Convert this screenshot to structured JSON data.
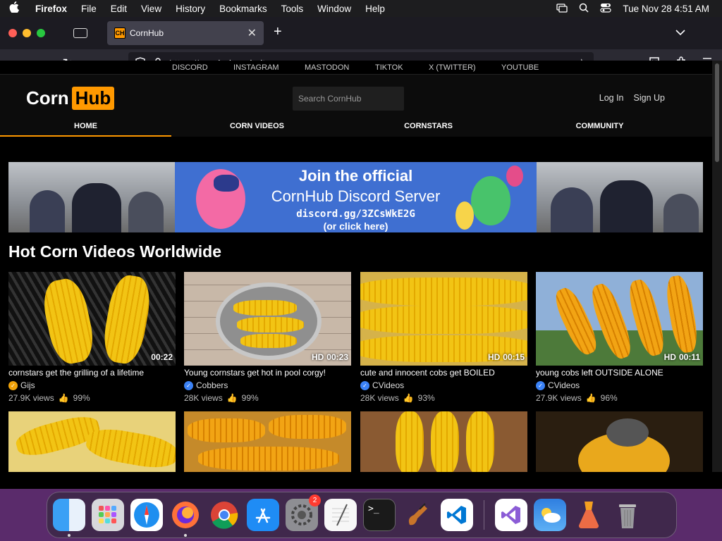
{
  "menubar": {
    "app": "Firefox",
    "items": [
      "File",
      "Edit",
      "View",
      "History",
      "Bookmarks",
      "Tools",
      "Window",
      "Help"
    ],
    "datetime": "Tue Nov 28  4:51 AM"
  },
  "browser": {
    "tab_title": "CornHub",
    "favicon_text": "CH",
    "url_proto": "https://",
    "url_host": "cornhub.website"
  },
  "site": {
    "social_links": [
      "DISCORD",
      "INSTAGRAM",
      "MASTODON",
      "TIKTOK",
      "X (TWITTER)",
      "YOUTUBE"
    ],
    "logo_left": "Corn",
    "logo_right": "Hub",
    "search_placeholder": "Search CornHub",
    "login": "Log In",
    "signup": "Sign Up",
    "nav": [
      "HOME",
      "CORN VIDEOS",
      "CORNSTARS",
      "COMMUNITY"
    ],
    "active_nav": "HOME",
    "banner": {
      "line1": "Join the official",
      "line2": "CornHub Discord Server",
      "line3": "discord.gg/3ZCsWkE2G",
      "line4": "(or click here)"
    },
    "section_title": "Hot Corn Videos Worldwide",
    "videos": [
      {
        "title": "cornstars get the grilling of a lifetime",
        "author": "Gijs",
        "badge_color": "#f0a30a",
        "views": "27.9K views",
        "rating": "99%",
        "hd": "",
        "duration": "00:22"
      },
      {
        "title": "Young cornstars get hot in pool corgy!",
        "author": "Cobbers",
        "badge_color": "#3b82f6",
        "views": "28K views",
        "rating": "99%",
        "hd": "HD",
        "duration": "00:23"
      },
      {
        "title": "cute and innocent cobs get BOILED",
        "author": "CVideos",
        "badge_color": "#3b82f6",
        "views": "28K views",
        "rating": "93%",
        "hd": "HD",
        "duration": "00:15"
      },
      {
        "title": "young cobs left OUTSIDE ALONE",
        "author": "CVideos",
        "badge_color": "#3b82f6",
        "views": "27.9K views",
        "rating": "96%",
        "hd": "HD",
        "duration": "00:11"
      }
    ]
  },
  "dock": {
    "apps": [
      "finder-icon",
      "launchpad-icon",
      "safari-icon",
      "firefox-icon",
      "chrome-icon",
      "app-store-icon",
      "system-settings-icon",
      "textedit-icon",
      "terminal-icon",
      "garageband-icon",
      "vscode-icon",
      "visual-studio-icon",
      "weather-icon",
      "app-icon",
      "trash-icon"
    ],
    "settings_badge": "2"
  },
  "colors": {
    "accent": "#ff9900",
    "banner_blue": "#3f6fd1"
  }
}
